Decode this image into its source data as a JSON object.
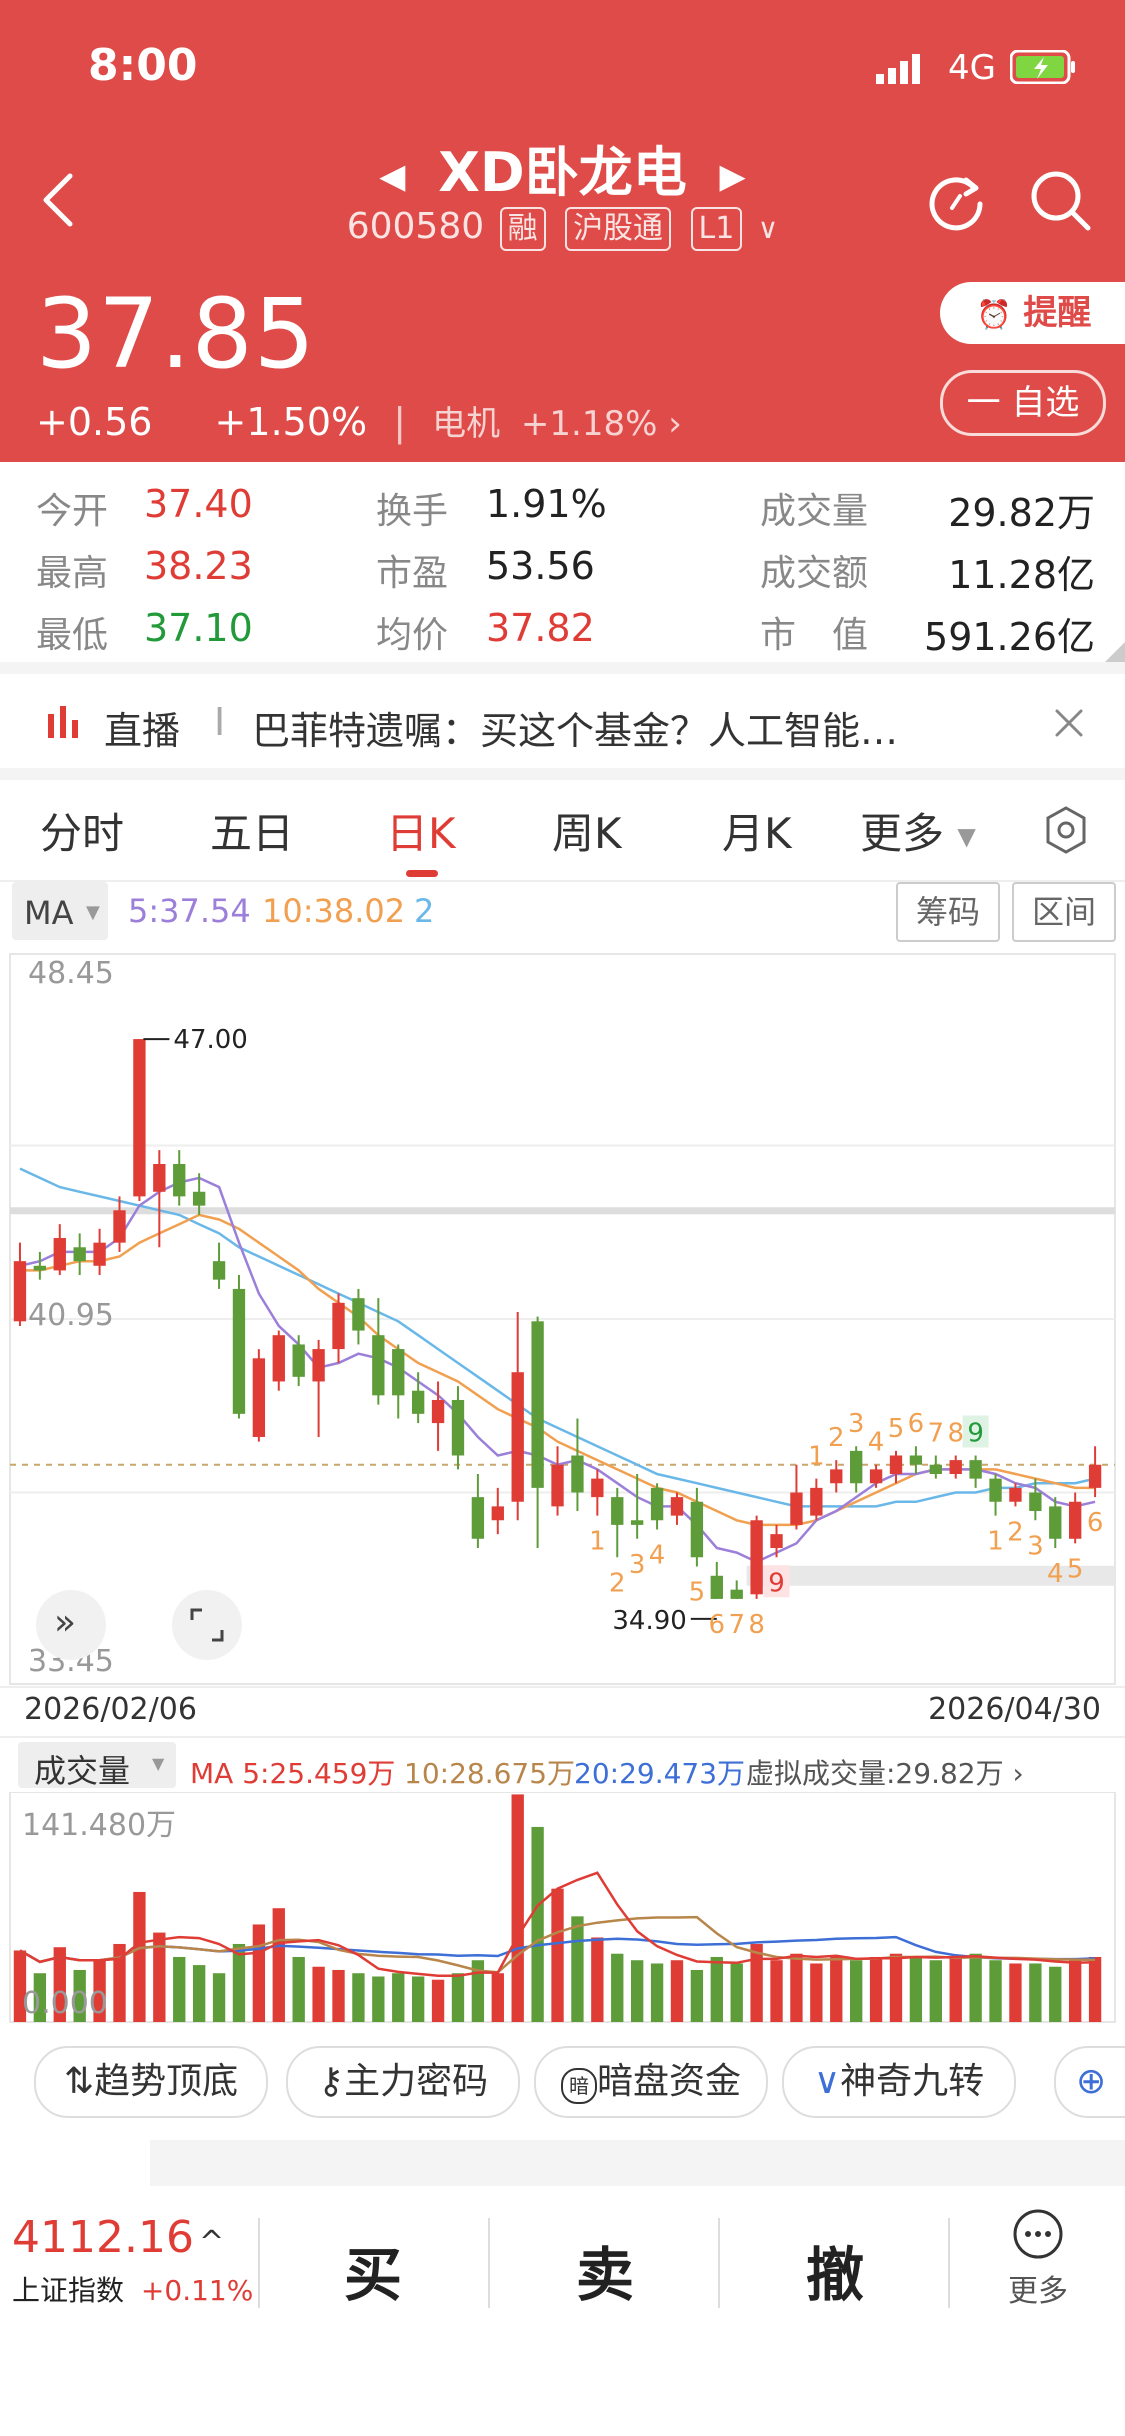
{
  "status": {
    "time": "8:00",
    "network": "4G"
  },
  "stock": {
    "name": "XD卧龙电",
    "code": "600580",
    "tags": [
      "融",
      "沪股通",
      "L1"
    ],
    "price": "37.85",
    "change": "+0.56",
    "change_pct": "+1.50%",
    "sector": "电机",
    "sector_pct": "+1.18%"
  },
  "actions": {
    "remind": "提醒",
    "watch": "一 自选"
  },
  "stats": {
    "open_label": "今开",
    "open": "37.40",
    "high_label": "最高",
    "high": "38.23",
    "low_label": "最低",
    "low": "37.10",
    "turnover_label": "换手",
    "turnover": "1.91%",
    "pe_label": "市盈",
    "pe": "53.56",
    "avg_label": "均价",
    "avg": "37.82",
    "vol_label": "成交量",
    "vol": "29.82万",
    "amt_label": "成交额",
    "amt": "11.28亿",
    "cap_label": "市　值",
    "cap": "591.26亿"
  },
  "live": {
    "label": "直播",
    "sep": "I",
    "text": "巴菲特遗嘱：买这个基金？人工智能…"
  },
  "tabs": [
    "分时",
    "五日",
    "日K",
    "周K",
    "月K",
    "更多"
  ],
  "active_tab": 2,
  "ma_bar": {
    "label": "MA",
    "ma5": "5:37.54",
    "ma10": "10:38.02",
    "ma20": "2",
    "btn_chips": "筹码",
    "btn_range": "区间"
  },
  "kline": {
    "y_top": "48.45",
    "y_mid": "40.95",
    "y_bottom": "33.45",
    "max_label": "47.00",
    "min_label": "34.90",
    "date_start": "2026/02/06",
    "date_end": "2026/04/30"
  },
  "volume": {
    "label": "成交量",
    "ma5": "MA 5:25.459万",
    "ma10": "10:28.675万",
    "ma20": "20:29.473万",
    "virtual": "虚拟成交量:29.82万",
    "max": "141.480万",
    "zero": "0.000"
  },
  "chips": [
    "趋势顶底",
    "主力密码",
    "暗盘资金",
    "神奇九转"
  ],
  "index": {
    "value": "4112.16",
    "name": "上证指数",
    "pct": "+0.11%"
  },
  "trade": {
    "buy": "买",
    "sell": "卖",
    "cancel": "撤",
    "more": "更多"
  },
  "colors": {
    "header": "#de4b48",
    "up": "#e03c36",
    "down": "#5e9c3a",
    "ma5": "#9b7fd9",
    "ma10": "#f0a050",
    "ma20": "#6ab8e8"
  },
  "chart_data": {
    "type": "candlestick",
    "ylim": [
      33.45,
      48.45
    ],
    "candles": [
      {
        "o": 40.9,
        "c": 42.2,
        "h": 42.6,
        "l": 40.8
      },
      {
        "o": 42.1,
        "c": 42.0,
        "h": 42.4,
        "l": 41.8
      },
      {
        "o": 42.0,
        "c": 42.7,
        "h": 43.0,
        "l": 41.9
      },
      {
        "o": 42.5,
        "c": 42.2,
        "h": 42.8,
        "l": 41.9
      },
      {
        "o": 42.1,
        "c": 42.6,
        "h": 42.9,
        "l": 41.9
      },
      {
        "o": 42.6,
        "c": 43.3,
        "h": 43.6,
        "l": 42.4
      },
      {
        "o": 43.6,
        "c": 47.0,
        "h": 47.0,
        "l": 43.5
      },
      {
        "o": 43.7,
        "c": 44.3,
        "h": 44.6,
        "l": 42.5
      },
      {
        "o": 44.3,
        "c": 43.6,
        "h": 44.6,
        "l": 43.4
      },
      {
        "o": 43.7,
        "c": 43.4,
        "h": 44.1,
        "l": 43.2
      },
      {
        "o": 42.2,
        "c": 41.8,
        "h": 42.6,
        "l": 41.6
      },
      {
        "o": 41.6,
        "c": 38.9,
        "h": 41.9,
        "l": 38.8
      },
      {
        "o": 38.4,
        "c": 40.1,
        "h": 40.3,
        "l": 38.3
      },
      {
        "o": 39.6,
        "c": 40.6,
        "h": 40.7,
        "l": 39.4
      },
      {
        "o": 40.4,
        "c": 39.7,
        "h": 40.6,
        "l": 39.5
      },
      {
        "o": 39.6,
        "c": 40.3,
        "h": 40.5,
        "l": 38.4
      },
      {
        "o": 40.3,
        "c": 41.3,
        "h": 41.5,
        "l": 40.0
      },
      {
        "o": 41.4,
        "c": 40.7,
        "h": 41.6,
        "l": 40.4
      },
      {
        "o": 40.6,
        "c": 39.3,
        "h": 41.4,
        "l": 39.1
      },
      {
        "o": 40.3,
        "c": 39.3,
        "h": 40.4,
        "l": 38.8
      },
      {
        "o": 39.4,
        "c": 38.9,
        "h": 39.8,
        "l": 38.7
      },
      {
        "o": 38.7,
        "c": 39.2,
        "h": 39.6,
        "l": 38.1
      },
      {
        "o": 39.2,
        "c": 38.0,
        "h": 39.5,
        "l": 37.7
      },
      {
        "o": 37.1,
        "c": 36.2,
        "h": 37.6,
        "l": 36.0
      },
      {
        "o": 36.6,
        "c": 36.9,
        "h": 37.3,
        "l": 36.3
      },
      {
        "o": 37.0,
        "c": 39.8,
        "h": 41.1,
        "l": 36.6
      },
      {
        "o": 40.9,
        "c": 37.3,
        "h": 41.0,
        "l": 36.0
      },
      {
        "o": 36.9,
        "c": 37.8,
        "h": 38.2,
        "l": 36.7
      },
      {
        "o": 38.0,
        "c": 37.2,
        "h": 38.8,
        "l": 36.8
      },
      {
        "o": 37.1,
        "c": 37.5,
        "h": 37.7,
        "l": 36.7
      },
      {
        "o": 37.1,
        "c": 36.5,
        "h": 37.3,
        "l": 35.8
      },
      {
        "o": 36.6,
        "c": 36.5,
        "h": 37.6,
        "l": 36.2
      },
      {
        "o": 37.3,
        "c": 36.6,
        "h": 37.4,
        "l": 36.4
      },
      {
        "o": 36.7,
        "c": 37.1,
        "h": 37.2,
        "l": 36.5
      },
      {
        "o": 37.0,
        "c": 35.8,
        "h": 37.3,
        "l": 35.6
      },
      {
        "o": 35.4,
        "c": 34.9,
        "h": 35.7,
        "l": 34.9
      },
      {
        "o": 35.1,
        "c": 34.9,
        "h": 35.3,
        "l": 34.9
      },
      {
        "o": 35.0,
        "c": 36.6,
        "h": 36.7,
        "l": 34.9
      },
      {
        "o": 36.0,
        "c": 36.3,
        "h": 36.5,
        "l": 35.8
      },
      {
        "o": 36.5,
        "c": 37.2,
        "h": 37.8,
        "l": 36.4
      },
      {
        "o": 36.7,
        "c": 37.3,
        "h": 37.5,
        "l": 36.6
      },
      {
        "o": 37.4,
        "c": 37.7,
        "h": 37.9,
        "l": 37.2
      },
      {
        "o": 38.1,
        "c": 37.4,
        "h": 38.2,
        "l": 37.2
      },
      {
        "o": 37.4,
        "c": 37.7,
        "h": 37.8,
        "l": 37.3
      },
      {
        "o": 37.6,
        "c": 38.0,
        "h": 38.1,
        "l": 37.4
      },
      {
        "o": 38.0,
        "c": 37.8,
        "h": 38.2,
        "l": 37.6
      },
      {
        "o": 37.8,
        "c": 37.6,
        "h": 38.0,
        "l": 37.5
      },
      {
        "o": 37.6,
        "c": 37.9,
        "h": 38.0,
        "l": 37.5
      },
      {
        "o": 37.9,
        "c": 37.5,
        "h": 38.0,
        "l": 37.3
      },
      {
        "o": 37.5,
        "c": 37.0,
        "h": 37.6,
        "l": 36.7
      },
      {
        "o": 37.0,
        "c": 37.3,
        "h": 37.4,
        "l": 36.9
      },
      {
        "o": 37.2,
        "c": 36.8,
        "h": 37.5,
        "l": 36.6
      },
      {
        "o": 36.9,
        "c": 36.2,
        "h": 37.1,
        "l": 36.0
      },
      {
        "o": 36.2,
        "c": 37.0,
        "h": 37.2,
        "l": 36.1
      },
      {
        "o": 37.3,
        "c": 37.8,
        "h": 38.2,
        "l": 37.1
      }
    ],
    "ma5": [
      42.1,
      42.2,
      42.4,
      42.4,
      42.4,
      42.7,
      43.4,
      43.7,
      43.9,
      44.0,
      43.8,
      42.6,
      41.5,
      40.8,
      40.4,
      39.9,
      40.0,
      40.2,
      40.1,
      39.9,
      39.6,
      39.3,
      38.9,
      38.4,
      38.0,
      38.1,
      38.0,
      37.8,
      37.9,
      37.7,
      37.4,
      37.1,
      36.9,
      36.9,
      36.5,
      36.0,
      35.9,
      35.7,
      35.9,
      36.1,
      36.6,
      36.8,
      37.1,
      37.4,
      37.6,
      37.6,
      37.7,
      37.7,
      37.7,
      37.6,
      37.4,
      37.3,
      37.0,
      36.9,
      37.0
    ],
    "ma10": [
      42.0,
      42.0,
      42.1,
      42.2,
      42.2,
      42.3,
      42.6,
      42.8,
      43.0,
      43.2,
      43.1,
      42.9,
      42.6,
      42.3,
      42.0,
      41.6,
      41.3,
      41.0,
      40.6,
      40.3,
      40.0,
      39.8,
      39.6,
      39.3,
      39.0,
      38.8,
      38.6,
      38.3,
      38.1,
      37.9,
      37.7,
      37.5,
      37.3,
      37.2,
      37.0,
      36.8,
      36.6,
      36.5,
      36.5,
      36.5,
      36.6,
      36.8,
      37.0,
      37.2,
      37.4,
      37.6,
      37.7,
      37.7,
      37.7,
      37.7,
      37.6,
      37.5,
      37.4,
      37.3,
      37.3
    ],
    "ma20": [
      44.2,
      44.0,
      43.8,
      43.7,
      43.6,
      43.5,
      43.4,
      43.3,
      43.2,
      43.0,
      42.8,
      42.5,
      42.3,
      42.1,
      41.9,
      41.7,
      41.5,
      41.3,
      41.1,
      40.9,
      40.6,
      40.3,
      40.0,
      39.7,
      39.4,
      39.1,
      38.8,
      38.6,
      38.4,
      38.2,
      38.0,
      37.8,
      37.6,
      37.5,
      37.4,
      37.3,
      37.2,
      37.1,
      37.0,
      36.9,
      36.9,
      36.9,
      36.9,
      36.9,
      37.0,
      37.0,
      37.1,
      37.2,
      37.2,
      37.3,
      37.3,
      37.4,
      37.4,
      37.4,
      37.5
    ],
    "signals": [
      {
        "i": 29,
        "t": "1",
        "up": false
      },
      {
        "i": 30,
        "t": "2",
        "up": false
      },
      {
        "i": 31,
        "t": "3",
        "up": false
      },
      {
        "i": 32,
        "t": "4",
        "up": false
      },
      {
        "i": 34,
        "t": "5",
        "up": false
      },
      {
        "i": 35,
        "t": "6",
        "up": false
      },
      {
        "i": 36,
        "t": "7",
        "up": false
      },
      {
        "i": 37,
        "t": "8",
        "up": false
      },
      {
        "i": 38,
        "t": "9",
        "up": false,
        "hl": "red"
      },
      {
        "i": 40,
        "t": "1",
        "up": true
      },
      {
        "i": 41,
        "t": "2",
        "up": true
      },
      {
        "i": 42,
        "t": "3",
        "up": true
      },
      {
        "i": 43,
        "t": "4",
        "up": true
      },
      {
        "i": 44,
        "t": "5",
        "up": true
      },
      {
        "i": 45,
        "t": "6",
        "up": true
      },
      {
        "i": 46,
        "t": "7",
        "up": true
      },
      {
        "i": 47,
        "t": "8",
        "up": true
      },
      {
        "i": 48,
        "t": "9",
        "up": true,
        "hl": "green"
      },
      {
        "i": 49,
        "t": "1",
        "up": false
      },
      {
        "i": 50,
        "t": "2",
        "up": false
      },
      {
        "i": 51,
        "t": "3",
        "up": false
      },
      {
        "i": 52,
        "t": "4",
        "up": false
      },
      {
        "i": 53,
        "t": "5",
        "up": false
      },
      {
        "i": 54,
        "t": "6",
        "up": false
      }
    ],
    "volume": [
      44,
      30,
      46,
      32,
      38,
      48,
      80,
      55,
      40,
      35,
      30,
      48,
      60,
      70,
      40,
      34,
      32,
      30,
      28,
      30,
      28,
      26,
      30,
      38,
      30,
      140,
      120,
      82,
      65,
      52,
      42,
      38,
      36,
      38,
      32,
      40,
      36,
      48,
      38,
      42,
      36,
      40,
      38,
      40,
      42,
      40,
      38,
      40,
      42,
      38,
      36,
      36,
      34,
      38,
      40
    ],
    "vol_ylim": [
      0,
      141.48
    ]
  }
}
